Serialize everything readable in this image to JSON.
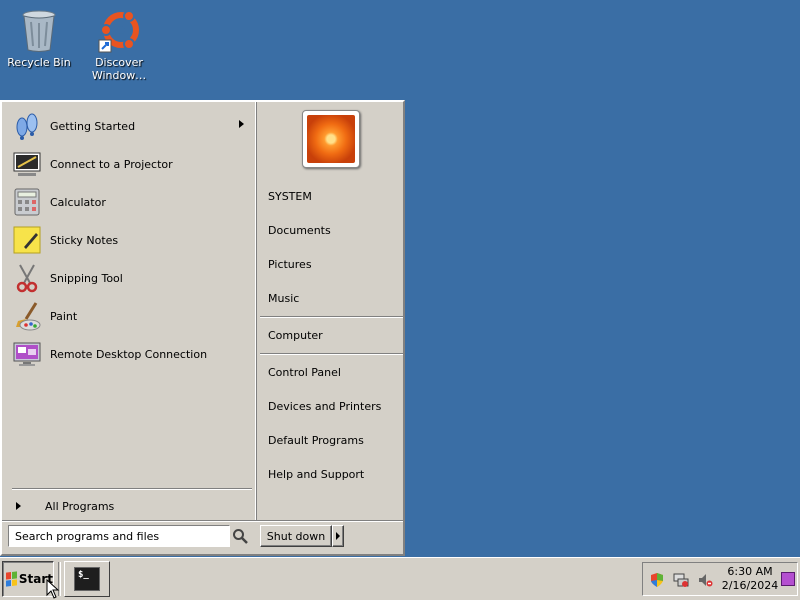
{
  "desktop": {
    "icons": [
      {
        "label": "Recycle Bin",
        "icon": "recycle-bin-icon"
      },
      {
        "label": "Discover Window…",
        "icon": "ubuntu-logo-icon"
      }
    ]
  },
  "start_menu": {
    "programs": [
      {
        "label": "Getting Started",
        "icon": "getting-started-icon",
        "has_submenu": true
      },
      {
        "label": "Connect to a Projector",
        "icon": "projector-icon"
      },
      {
        "label": "Calculator",
        "icon": "calculator-icon"
      },
      {
        "label": "Sticky Notes",
        "icon": "sticky-notes-icon"
      },
      {
        "label": "Snipping Tool",
        "icon": "scissors-icon"
      },
      {
        "label": "Paint",
        "icon": "paint-icon"
      },
      {
        "label": "Remote Desktop Connection",
        "icon": "remote-desktop-icon"
      }
    ],
    "all_programs_label": "All Programs",
    "search_placeholder": "Search programs and files",
    "places": [
      "SYSTEM",
      "Documents",
      "Pictures",
      "Music",
      "Computer",
      "Control Panel",
      "Devices and Printers",
      "Default Programs",
      "Help and Support"
    ],
    "shutdown_label": "Shut down"
  },
  "taskbar": {
    "start_label": "Start",
    "terminal_glyph": "$_",
    "clock": {
      "time": "6:30 AM",
      "date": "2/16/2024"
    }
  },
  "colors": {
    "desktop": "#3a6ea5",
    "chrome": "#d4d0c8"
  }
}
